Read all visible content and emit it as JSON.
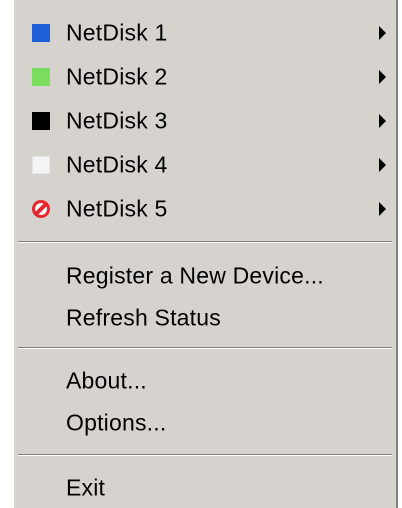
{
  "menu": {
    "disks": [
      {
        "label": "NetDisk 1",
        "icon": "blue-square-icon",
        "color": "#1e5fd8"
      },
      {
        "label": "NetDisk 2",
        "icon": "green-square-icon",
        "color": "#7bdd5e"
      },
      {
        "label": "NetDisk 3",
        "icon": "black-square-icon",
        "color": "#000000"
      },
      {
        "label": "NetDisk 4",
        "icon": "white-square-icon",
        "color": "#f4f4f4"
      },
      {
        "label": "NetDisk 5",
        "icon": "no-entry-icon",
        "color": "#e8262d"
      }
    ],
    "register_label": "Register a New Device...",
    "refresh_label": "Refresh Status",
    "about_label": "About...",
    "options_label": "Options...",
    "exit_label": "Exit"
  }
}
